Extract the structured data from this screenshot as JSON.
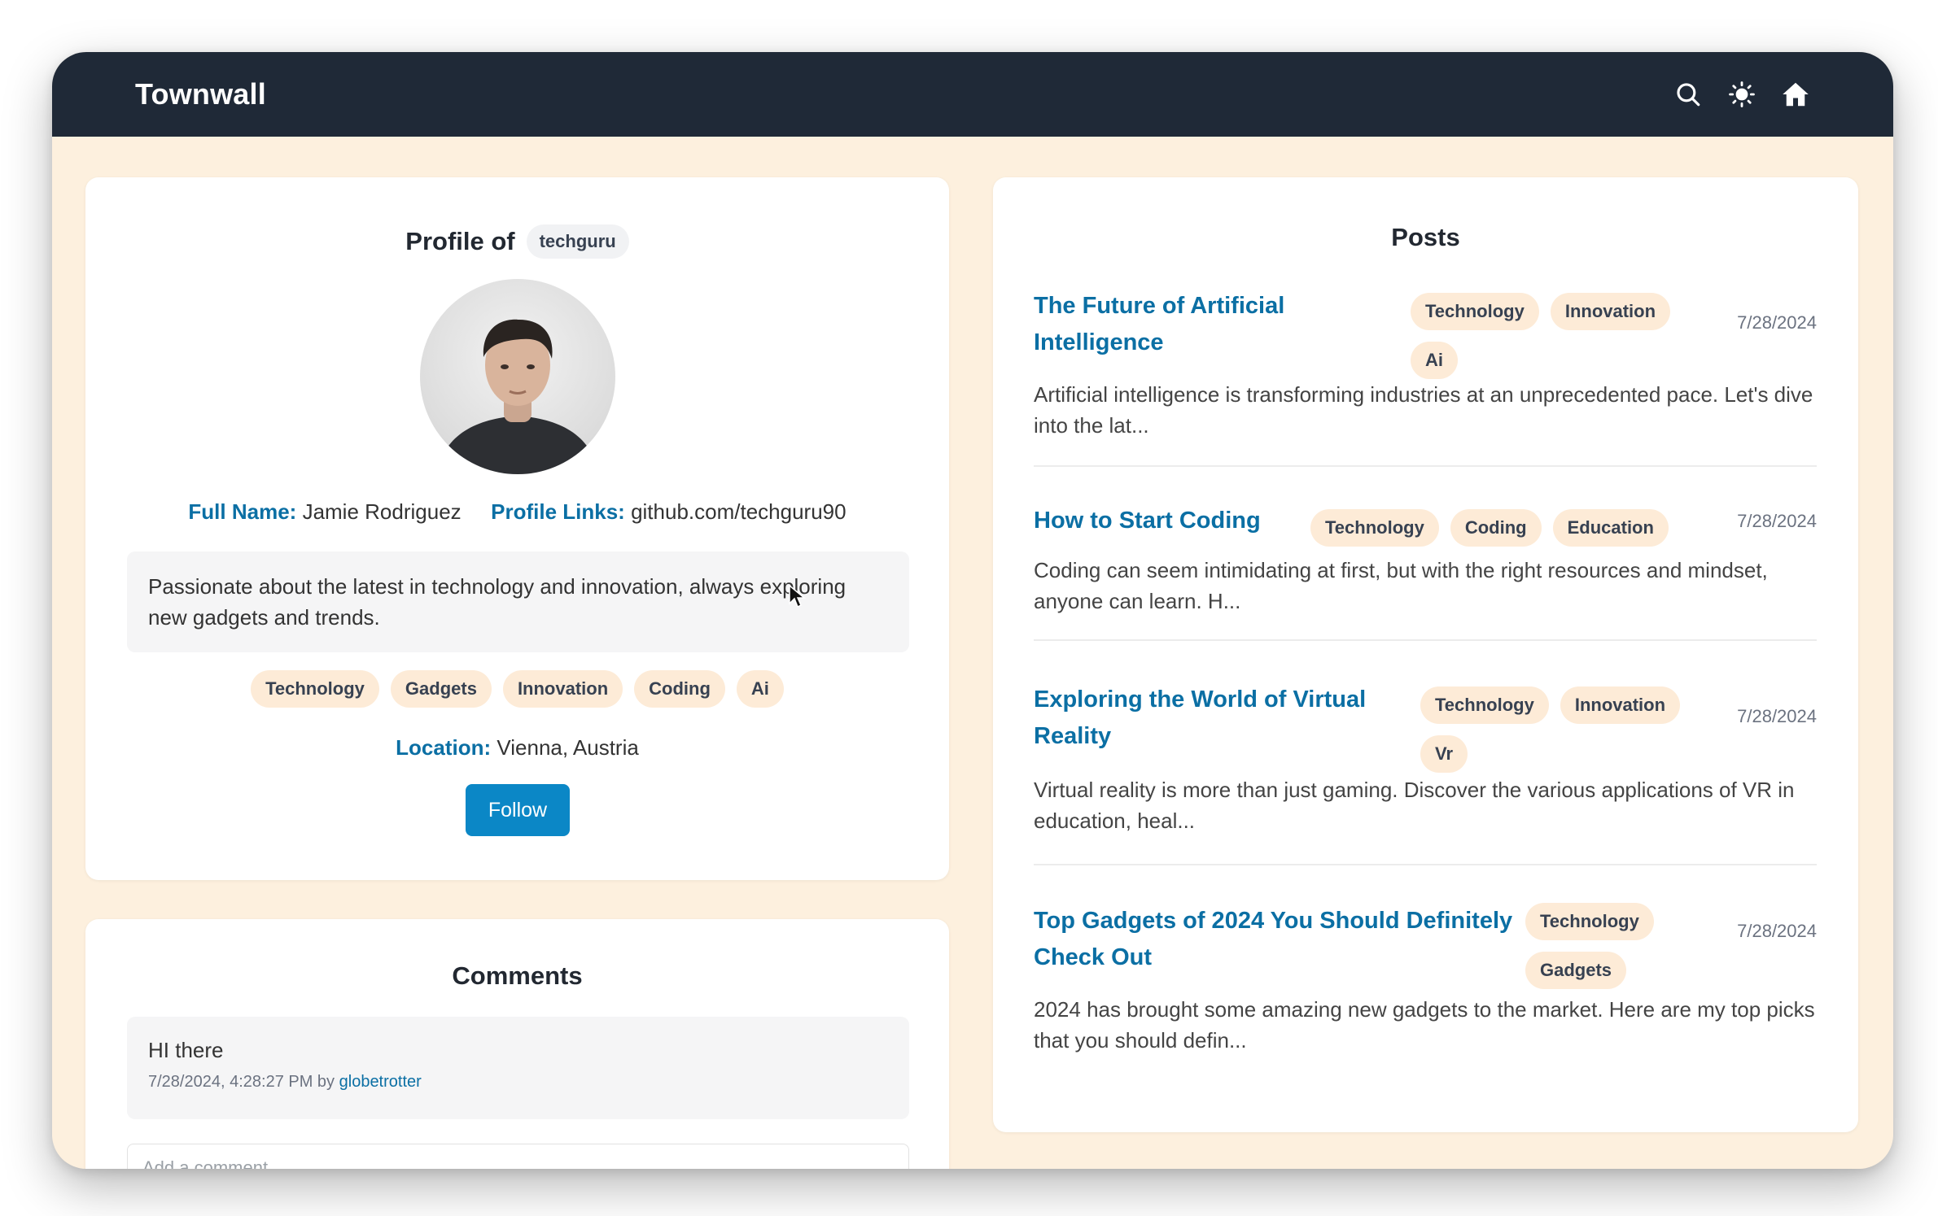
{
  "app": {
    "brand": "Townwall"
  },
  "nav": {
    "icons": [
      "search-icon",
      "sun-icon",
      "home-icon"
    ]
  },
  "profile": {
    "heading": "Profile of",
    "username": "techguru",
    "full_name_label": "Full Name:",
    "full_name": "Jamie Rodriguez",
    "links_label": "Profile Links:",
    "links": "github.com/techguru90",
    "bio": "Passionate about the latest in technology and innovation, always exploring new gadgets and trends.",
    "tags": [
      "Technology",
      "Gadgets",
      "Innovation",
      "Coding",
      "Ai"
    ],
    "location_label": "Location:",
    "location": "Vienna, Austria",
    "follow_label": "Follow"
  },
  "comments": {
    "title": "Comments",
    "items": [
      {
        "text": "HI there",
        "meta": "7/28/2024, 4:28:27 PM by",
        "author": "globetrotter"
      }
    ],
    "input_placeholder": "Add a comment..."
  },
  "posts": {
    "title": "Posts",
    "items": [
      {
        "title_line1": "The Future of Artificial",
        "title_line2": "Intelligence",
        "tags": [
          "Technology",
          "Innovation",
          "Ai"
        ],
        "date": "7/28/2024",
        "excerpt": "Artificial intelligence is transforming industries at an unprecedented pace. Let's dive into the lat..."
      },
      {
        "title_line1": "How to Start Coding",
        "title_line2": "",
        "tags": [
          "Technology",
          "Coding",
          "Education"
        ],
        "date": "7/28/2024",
        "excerpt": "Coding can seem intimidating at first, but with the right resources and mindset, anyone can learn. H..."
      },
      {
        "title_line1": "Exploring the World of Virtual",
        "title_line2": "Reality",
        "tags": [
          "Technology",
          "Innovation",
          "Vr"
        ],
        "date": "7/28/2024",
        "excerpt": "Virtual reality is more than just gaming. Discover the various applications of VR in education, heal..."
      },
      {
        "title_line1": "Top Gadgets of 2024 You Should Definitely",
        "title_line2": "Check Out",
        "tags": [
          "Technology",
          "Gadgets"
        ],
        "date": "7/28/2024",
        "excerpt": "2024 has brought some amazing new gadgets to the market. Here are my top picks that you should defin..."
      }
    ]
  },
  "colors": {
    "navbar": "#1f2937",
    "background": "#fdf0de",
    "accent": "#0b6fa4",
    "button": "#0b87c6",
    "tag": "#fdebd7"
  }
}
